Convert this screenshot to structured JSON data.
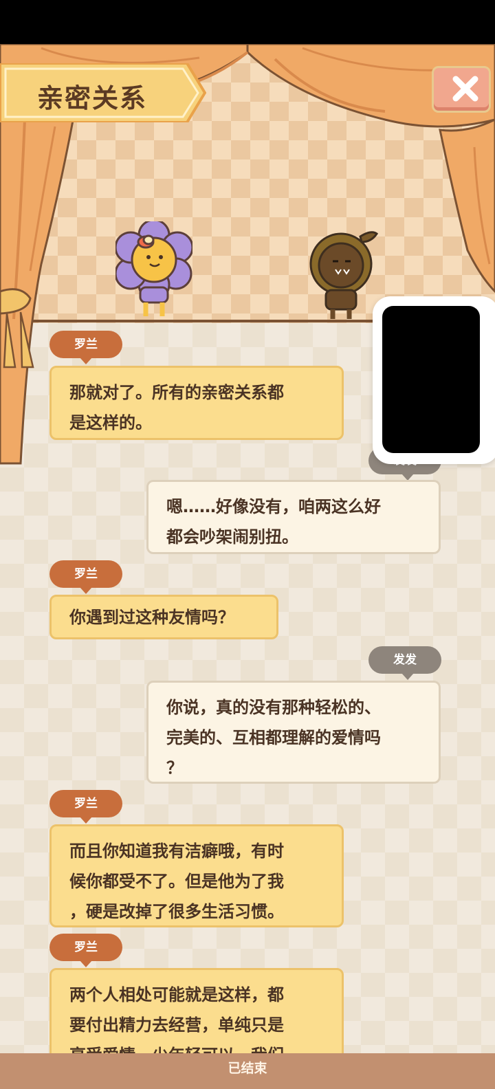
{
  "header": {
    "title": "亲密关系",
    "close_icon": "close-x-icon"
  },
  "characters": [
    {
      "name": "罗兰",
      "icon": "purple-flower-character"
    },
    {
      "name": "发发",
      "icon": "brown-sunflower-character"
    }
  ],
  "messages": [
    {
      "speaker": "罗兰",
      "side": "left",
      "text_lines": [
        "那就对了。所有的亲密关系都",
        "是这样的。"
      ]
    },
    {
      "speaker": "发发",
      "side": "right",
      "text_lines": [
        "嗯……好像没有，咱两这么好",
        "都会吵架闹别扭。"
      ]
    },
    {
      "speaker": "罗兰",
      "side": "left",
      "text_lines": [
        "你遇到过这种友情吗？"
      ]
    },
    {
      "speaker": "发发",
      "side": "right",
      "text_lines": [
        "你说，真的没有那种轻松的、",
        "完美的、互相都理解的爱情吗",
        "？"
      ]
    },
    {
      "speaker": "罗兰",
      "side": "left",
      "text_lines": [
        "而且你知道我有洁癖哦，有时",
        "候你都受不了。但是他为了我",
        "，硬是改掉了很多生活习惯。"
      ]
    },
    {
      "speaker": "罗兰",
      "side": "left",
      "text_lines": [
        "两个人相处可能就是这样，都",
        "要付出精力去经营，单纯只是",
        "享受爱情，少年轻可以，我们"
      ]
    }
  ],
  "footer": {
    "label": "已结束"
  },
  "colors": {
    "left_tag": "#c86e3c",
    "right_tag": "#8e857c",
    "left_bubble": "#fbdd8e",
    "right_bubble": "#fcf4e4",
    "curtain": "#f0a966"
  }
}
